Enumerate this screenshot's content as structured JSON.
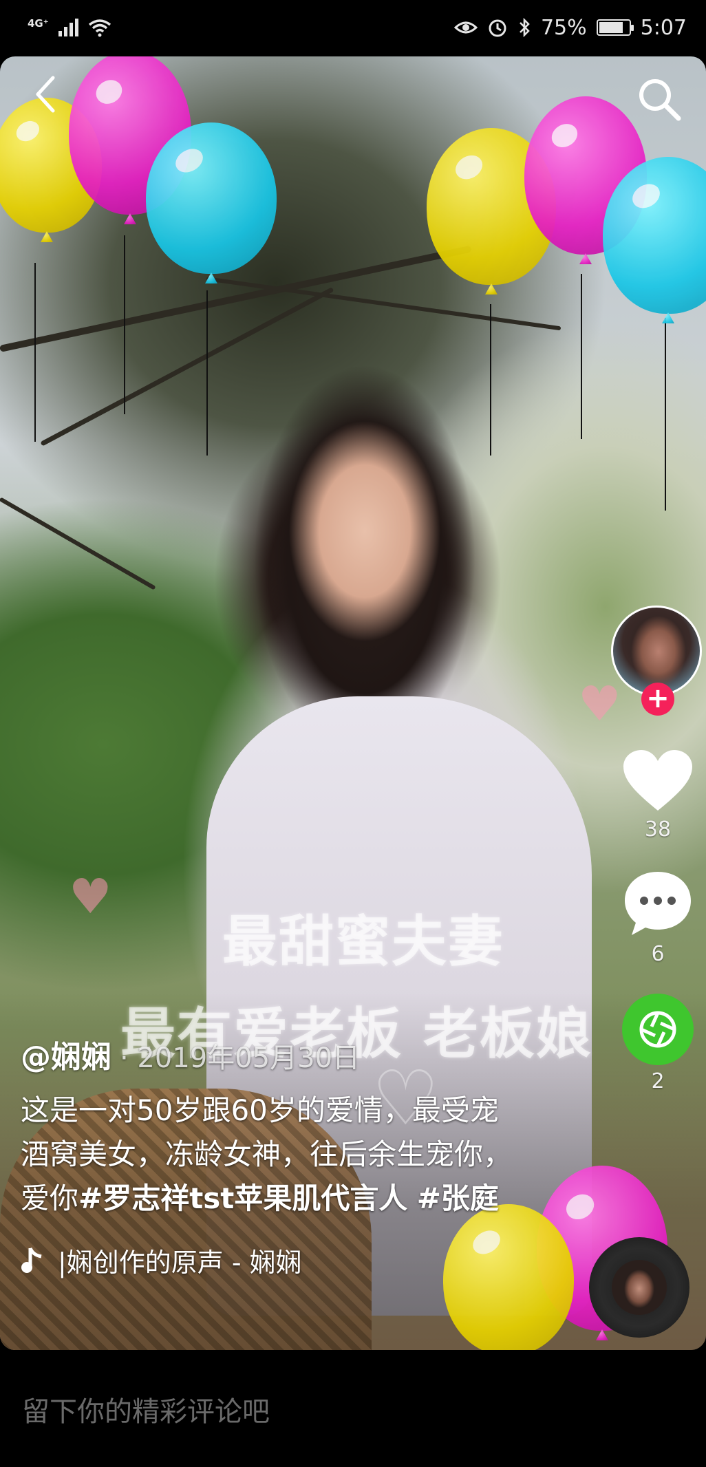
{
  "status_bar": {
    "network": "4G⁺",
    "battery": "75%",
    "time": "5:07"
  },
  "video": {
    "caption_line_1": "最甜蜜夫妻",
    "caption_line_2": "最有爱老板 老板娘"
  },
  "actions": {
    "like_count": "38",
    "comment_count": "6",
    "share_count": "2"
  },
  "post": {
    "author": "@娴娴",
    "date": "· 2019年05月30日",
    "description_text": "这是一对50岁跟60岁的爱情，最受宠酒窝美女，冻龄女神，往后余生宠你，爱你",
    "hashtag_1": "#罗志祥tst苹果肌代言人",
    "hashtag_2": "#张庭",
    "music": "|娴创作的原声 - 娴娴"
  },
  "comment": {
    "placeholder": "留下你的精彩评论吧"
  },
  "icons": {
    "back": "back-arrow-icon",
    "search": "search-icon",
    "like": "heart-icon",
    "comment": "comment-bubble-icon",
    "share": "share-shutter-icon",
    "music": "music-note-icon"
  }
}
